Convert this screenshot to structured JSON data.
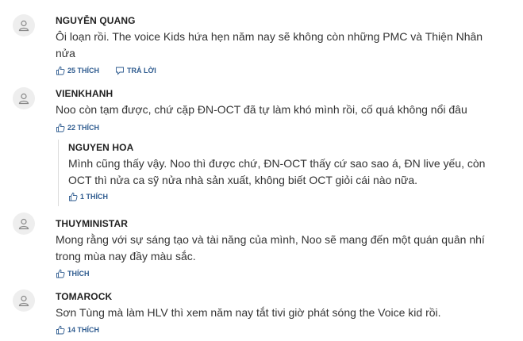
{
  "comments": [
    {
      "author": "NGUYỄN QUANG",
      "lines": [
        "Ôi loạn rồi. The voice Kids hứa hẹn năm nay sẽ không còn những PMC và Thiện Nhân",
        "nửa"
      ],
      "like_label": "25 THÍCH",
      "reply_label": "TRẢ LỜI"
    },
    {
      "author": "VIENKHANH",
      "lines": [
        "Noo còn tạm được, chứ cặp ĐN-OCT đã tự làm khó mình rồi, cố quá không nổi đâu"
      ],
      "like_label": "22 THÍCH",
      "reply": {
        "author": "NGUYEN HOA",
        "lines": [
          "Mình cũng thấy vậy. Noo thì được chứ, ĐN-OCT thấy cứ sao sao á, ĐN live yếu, còn",
          "OCT thì nửa ca sỹ nửa nhà sản xuất, không biết OCT giỏi cái nào nữa."
        ],
        "like_label": "1 THÍCH"
      }
    },
    {
      "author": "THUYMINISTAR",
      "lines": [
        "Mong rằng với sự sáng tạo và tài năng của mình, Noo sẽ mang đến một quán quân nhí",
        "trong mùa nay đầy màu sắc."
      ],
      "like_label": "THÍCH"
    },
    {
      "author": "TOMAROCK",
      "lines": [
        "Sơn Tùng mà làm HLV thì xem năm nay tắt tivi giờ phát sóng the Voice kid rồi."
      ],
      "like_label": "14 THÍCH"
    }
  ],
  "icons": {
    "avatar": "user-icon",
    "like": "thumbs-up-icon",
    "reply": "reply-icon"
  },
  "colors": {
    "action": "#2e5b8f",
    "avatar_bg": "#eeeeee",
    "text": "#333333"
  }
}
